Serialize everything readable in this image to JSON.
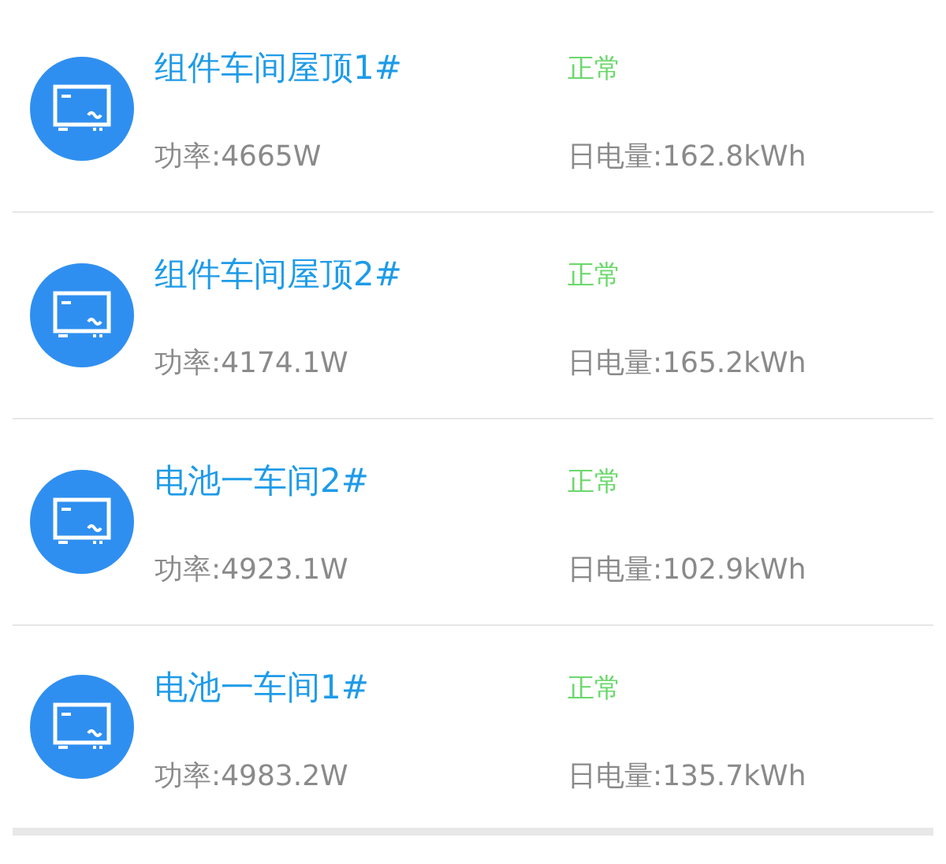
{
  "devices": [
    {
      "name": "组件车间屋顶1#",
      "status": {
        "text": "正常",
        "kind": "normal"
      },
      "power": "功率:4665W",
      "energy": "日电量:162.8kWh"
    },
    {
      "name": "组件车间屋顶2#",
      "status": {
        "text": "正常",
        "kind": "normal"
      },
      "power": "功率:4174.1W",
      "energy": "日电量:165.2kWh"
    },
    {
      "name": "电池一车间2#",
      "status": {
        "text": "正常",
        "kind": "normal"
      },
      "power": "功率:4923.1W",
      "energy": "日电量:102.9kWh"
    },
    {
      "name": "电池一车间1#",
      "status": {
        "text": "正常",
        "kind": "normal"
      },
      "power": "功率:4983.2W",
      "energy": "日电量:135.7kWh"
    }
  ]
}
